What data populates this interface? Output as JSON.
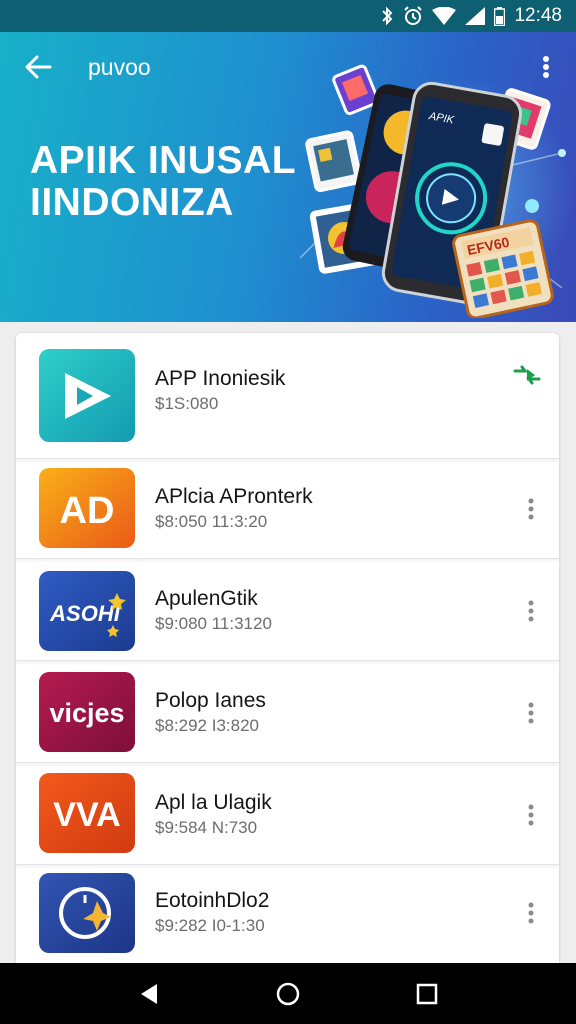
{
  "status_bar": {
    "time": "12:48",
    "icons": [
      "bluetooth-icon",
      "alarm-icon",
      "wifi-icon",
      "signal-icon",
      "battery-icon"
    ]
  },
  "app_bar": {
    "title": "puvoo",
    "back_icon": "arrow-left-icon",
    "menu_icon": "more-vertical-icon"
  },
  "hero": {
    "title_line1": "APIIK INUSAL",
    "title_line2": "IINDONIZA",
    "carousel": {
      "total": 3,
      "active": 1
    },
    "phone_screen_text": "APIK",
    "badge_text": "EFV60",
    "colors": {
      "gradient_start": "#18b0c9",
      "gradient_end": "#3b49b8"
    }
  },
  "apps": [
    {
      "name": "APP Inoniesik",
      "meta": "$1S:080",
      "icon_text": "",
      "icon": "play-icon",
      "action": "swap-arrows-icon",
      "colors": [
        "#22c3c4",
        "#138fa8"
      ]
    },
    {
      "name": "APlcia APronterk",
      "meta": "$8:050 11:3:20",
      "icon_text": "AD",
      "icon": "ad-logo-icon",
      "action": "more-vertical-icon",
      "colors": [
        "#f9b019",
        "#ea5a17"
      ]
    },
    {
      "name": "ApulenGtik",
      "meta": "$9:080 11:3120",
      "icon_text": "ASOHI",
      "icon": "asohi-logo-icon",
      "action": "more-vertical-icon",
      "colors": [
        "#2c56bb",
        "#1c3b8f"
      ]
    },
    {
      "name": "Polop Ianes",
      "meta": "$8:292 I3:820",
      "icon_text": "vicjes",
      "icon": "vicjes-logo-icon",
      "action": "more-vertical-icon",
      "colors": [
        "#b0184a",
        "#7d0f38"
      ]
    },
    {
      "name": "Apl la Ulagik",
      "meta": "$9:584 N:730",
      "icon_text": "VVA",
      "icon": "wa-logo-icon",
      "action": "more-vertical-icon",
      "colors": [
        "#ef5219",
        "#d13a10"
      ]
    },
    {
      "name": "EotoinhDlo2",
      "meta": "$9:282 I0-1:30",
      "icon_text": "",
      "icon": "compass-icon",
      "action": "more-vertical-icon",
      "colors": [
        "#2c4ba8",
        "#1d3586"
      ]
    }
  ],
  "nav_bar": {
    "buttons": [
      "back-triangle-icon",
      "home-circle-icon",
      "recents-square-icon"
    ]
  }
}
